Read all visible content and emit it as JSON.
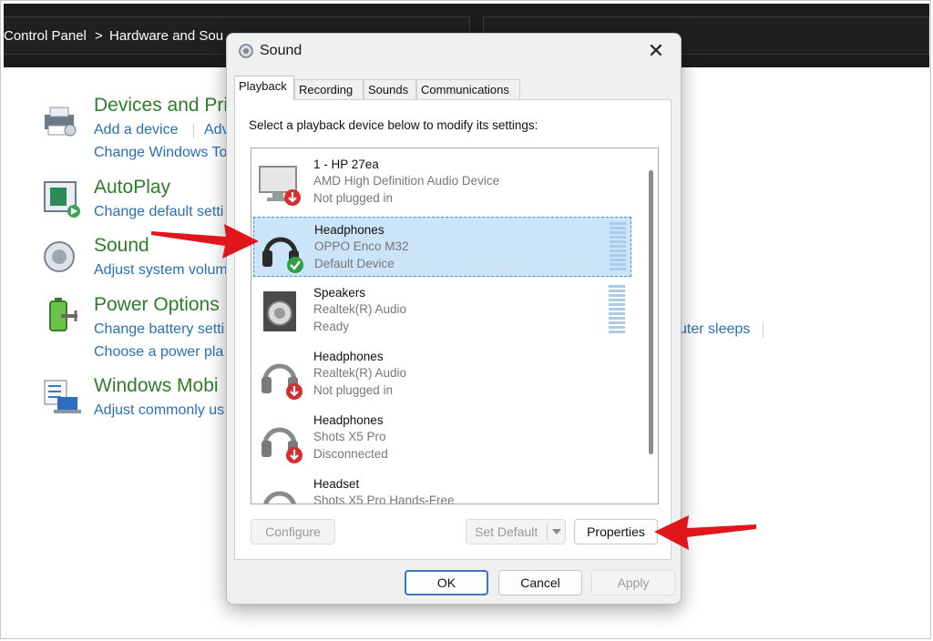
{
  "control_panel": {
    "breadcrumb": [
      "Control Panel",
      ">",
      "Hardware and Sou"
    ],
    "sections": [
      {
        "title": "Devices and Pri",
        "links": [
          "Add a device",
          "Adv"
        ],
        "links2": [
          "Change Windows To"
        ]
      },
      {
        "title": "AutoPlay",
        "links": [
          "Change default setti"
        ]
      },
      {
        "title": "Sound",
        "links": [
          "Adjust system volum"
        ]
      },
      {
        "title": "Power Options",
        "links": [
          "Change battery setti"
        ],
        "links2": [
          "Choose a power pla"
        ],
        "extra_link": "uter sleeps"
      },
      {
        "title": "Windows Mobi",
        "links": [
          "Adjust commonly us"
        ]
      }
    ]
  },
  "dialog": {
    "title": "Sound",
    "close_glyph": "✕",
    "tabs": [
      "Playback",
      "Recording",
      "Sounds",
      "Communications"
    ],
    "active_tab": "Playback",
    "instruction": "Select a playback device below to modify its settings:",
    "devices": [
      {
        "name": "1 - HP 27ea",
        "driver": "AMD High Definition Audio Device",
        "status": "Not plugged in",
        "icon": "monitor-icon"
      },
      {
        "name": "Headphones",
        "driver": "OPPO Enco M32",
        "status": "Default Device",
        "icon": "headphones-icon",
        "selected": true
      },
      {
        "name": "Speakers",
        "driver": "Realtek(R) Audio",
        "status": "Ready",
        "icon": "speaker-icon"
      },
      {
        "name": "Headphones",
        "driver": "Realtek(R) Audio",
        "status": "Not plugged in",
        "icon": "headphones-icon"
      },
      {
        "name": "Headphones",
        "driver": "Shots X5 Pro",
        "status": "Disconnected",
        "icon": "headphones-icon"
      },
      {
        "name": "Headset",
        "driver": "Shots X5 Pro Hands-Free",
        "status": "",
        "icon": "headset-icon"
      }
    ],
    "buttons": {
      "configure": "Configure",
      "set_default": "Set Default",
      "properties": "Properties",
      "ok": "OK",
      "cancel": "Cancel",
      "apply": "Apply"
    }
  },
  "colors": {
    "selection_bg": "#cce4f7",
    "link": "#2a6fb5",
    "section_title": "#2f7d2a",
    "annotation_arrow": "#e0161b",
    "status_default": "#2ea043",
    "status_unplugged": "#d32f2f"
  }
}
